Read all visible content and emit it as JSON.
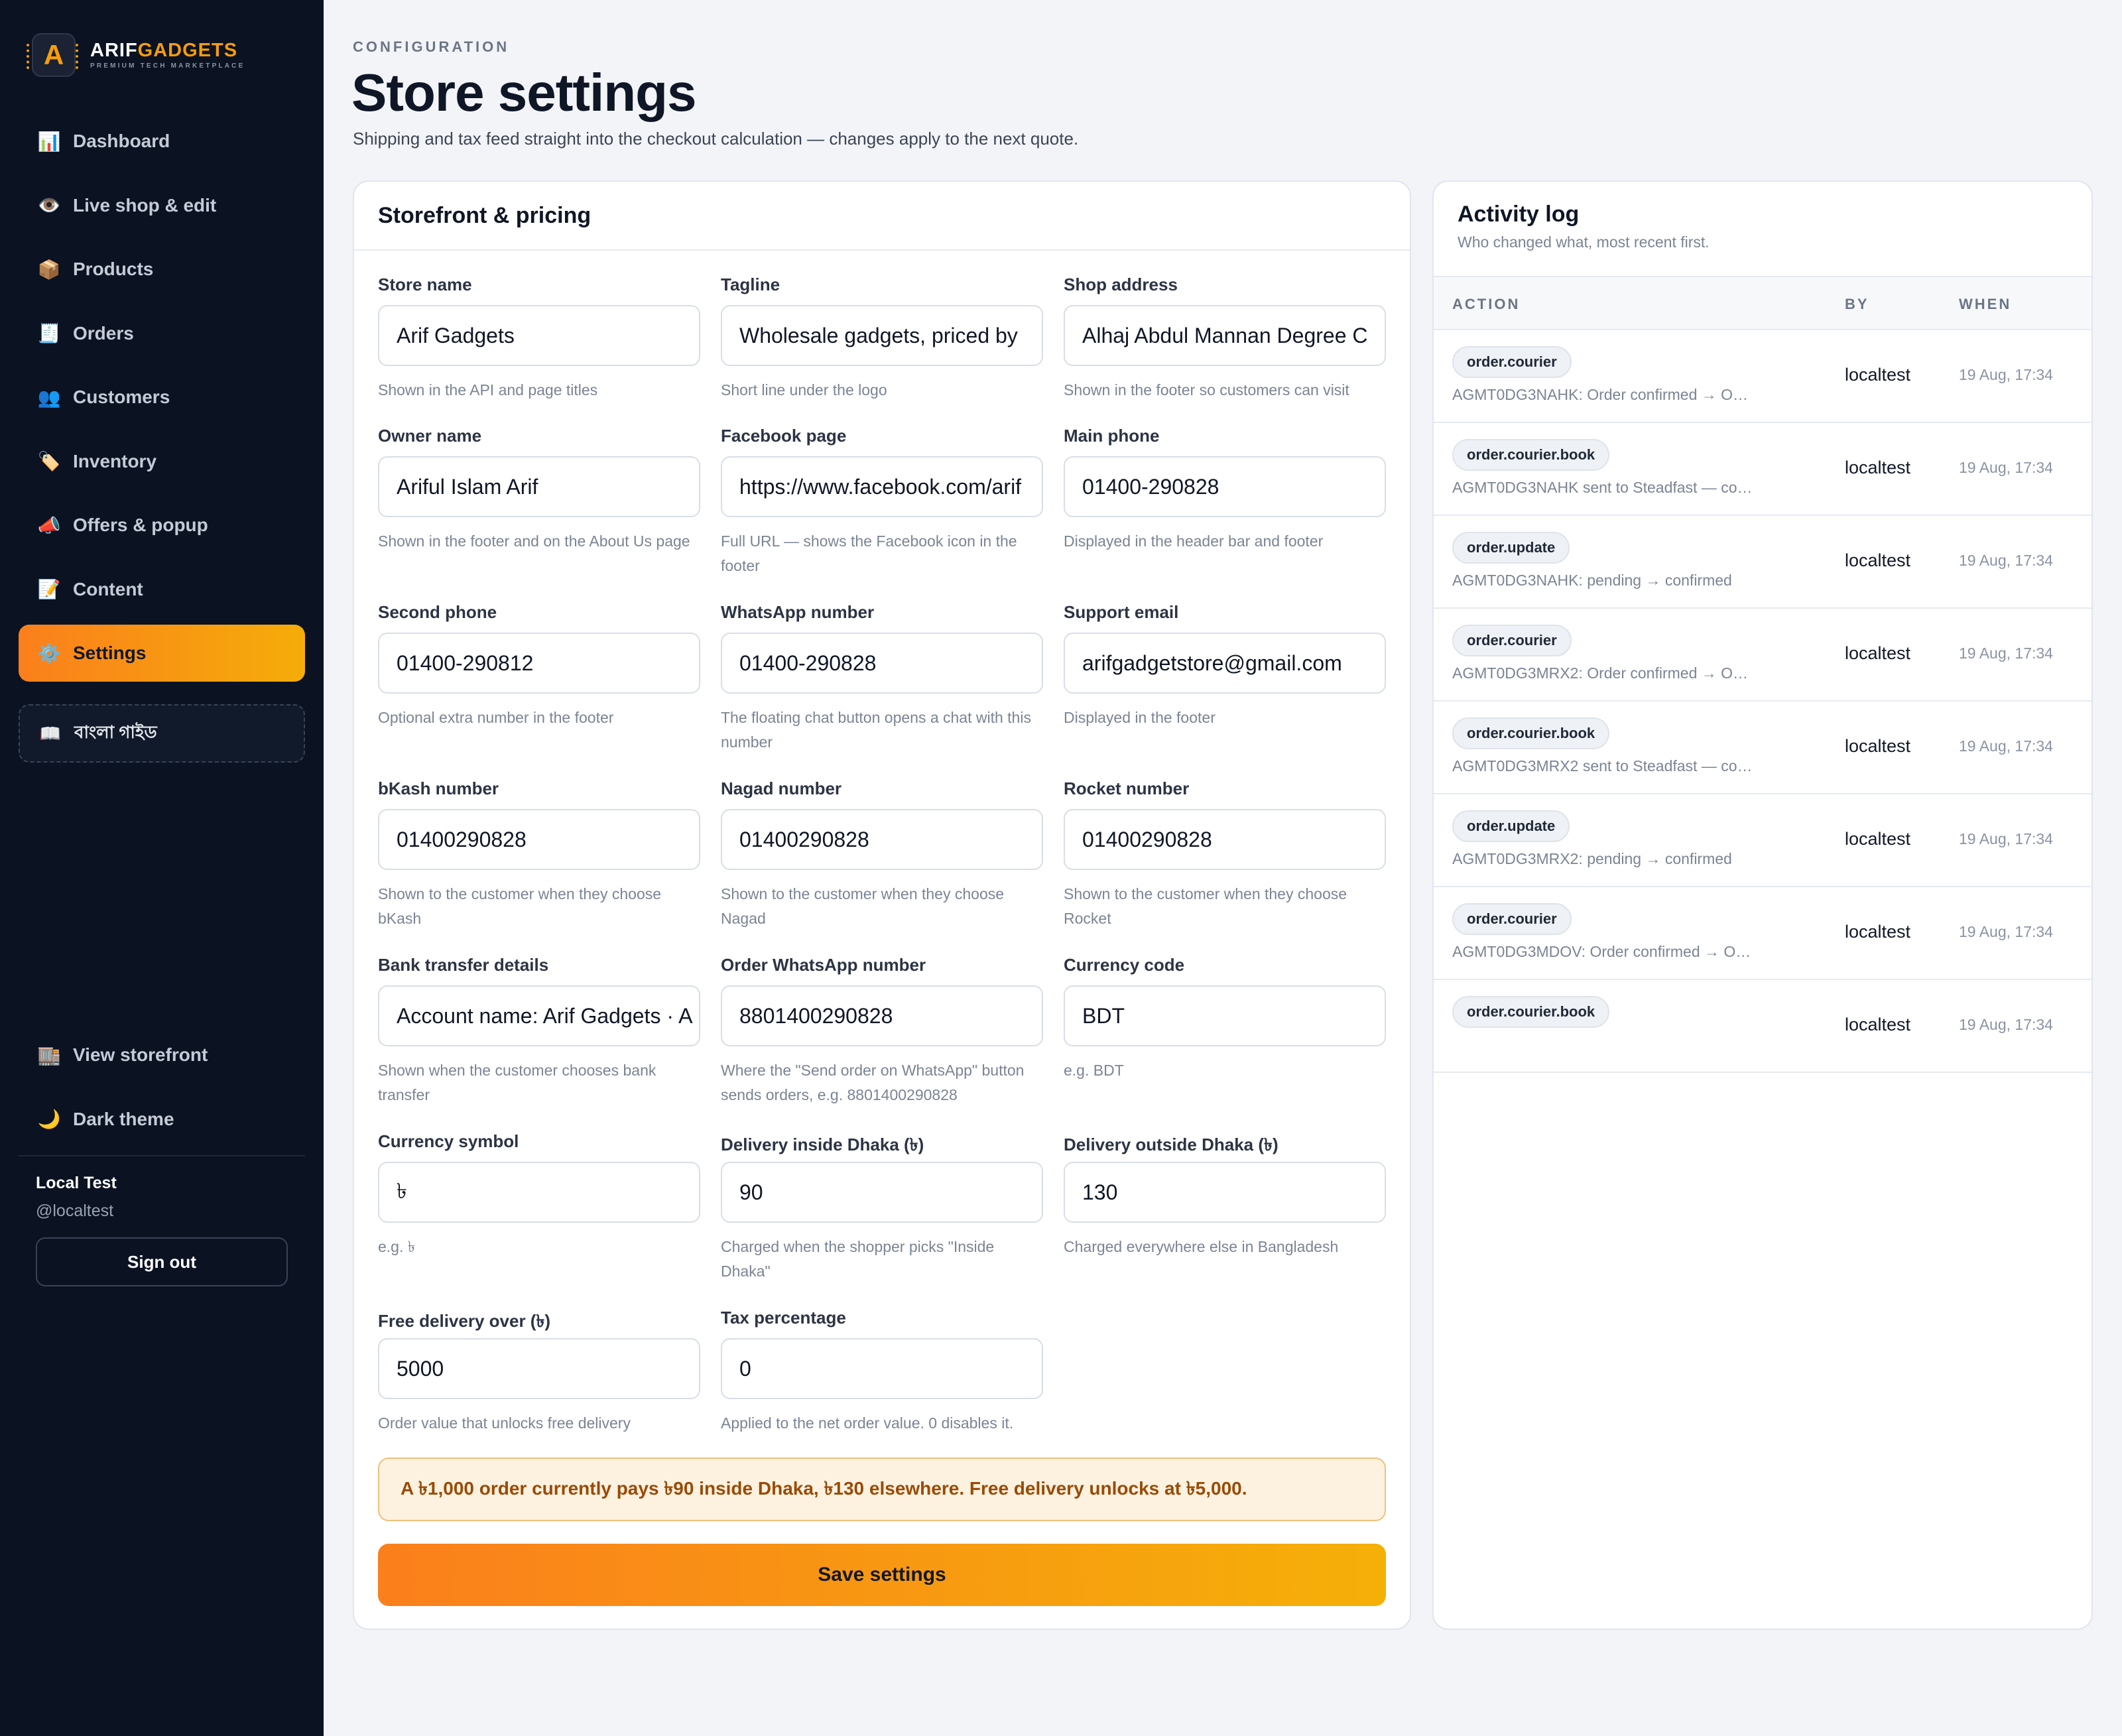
{
  "brand": {
    "name_part1": "ARIF",
    "name_part2": "GADGETS",
    "tagline": "PREMIUM TECH MARKETPLACE",
    "logo_letter": "A"
  },
  "sidebar": {
    "items": [
      {
        "label": "Dashboard",
        "icon": "📊"
      },
      {
        "label": "Live shop & edit",
        "icon": "👁️"
      },
      {
        "label": "Products",
        "icon": "📦"
      },
      {
        "label": "Orders",
        "icon": "🧾"
      },
      {
        "label": "Customers",
        "icon": "👥"
      },
      {
        "label": "Inventory",
        "icon": "🏷️"
      },
      {
        "label": "Offers & popup",
        "icon": "📣"
      },
      {
        "label": "Content",
        "icon": "📝"
      },
      {
        "label": "Settings",
        "icon": "⚙️",
        "active": true
      }
    ],
    "guide": {
      "label": "বাংলা গাইড",
      "icon": "📖"
    },
    "bottom": [
      {
        "label": "View storefront",
        "icon": "🏬"
      },
      {
        "label": "Dark theme",
        "icon": "🌙"
      }
    ],
    "user": {
      "name": "Local Test",
      "handle": "@localtest"
    },
    "signout_label": "Sign out"
  },
  "header": {
    "eyebrow": "CONFIGURATION",
    "title": "Store settings",
    "description": "Shipping and tax feed straight into the checkout calculation — changes apply to the next quote."
  },
  "settings": {
    "panel_title": "Storefront & pricing",
    "fields": [
      {
        "label": "Store name",
        "value": "Arif Gadgets",
        "hint": "Shown in the API and page titles"
      },
      {
        "label": "Tagline",
        "value": "Wholesale gadgets, priced by",
        "hint": "Short line under the logo"
      },
      {
        "label": "Shop address",
        "value": "Alhaj Abdul Mannan Degree C",
        "hint": "Shown in the footer so customers can visit"
      },
      {
        "label": "Owner name",
        "value": "Ariful Islam Arif",
        "hint": "Shown in the footer and on the About Us page"
      },
      {
        "label": "Facebook page",
        "value": "https://www.facebook.com/arif",
        "hint": "Full URL — shows the Facebook icon in the footer"
      },
      {
        "label": "Main phone",
        "value": "01400-290828",
        "hint": "Displayed in the header bar and footer"
      },
      {
        "label": "Second phone",
        "value": "01400-290812",
        "hint": "Optional extra number in the footer"
      },
      {
        "label": "WhatsApp number",
        "value": "01400-290828",
        "hint": "The floating chat button opens a chat with this number"
      },
      {
        "label": "Support email",
        "value": "arifgadgetstore@gmail.com",
        "hint": "Displayed in the footer"
      },
      {
        "label": "bKash number",
        "value": "01400290828",
        "hint": "Shown to the customer when they choose bKash"
      },
      {
        "label": "Nagad number",
        "value": "01400290828",
        "hint": "Shown to the customer when they choose Nagad"
      },
      {
        "label": "Rocket number",
        "value": "01400290828",
        "hint": "Shown to the customer when they choose Rocket"
      },
      {
        "label": "Bank transfer details",
        "value": "Account name: Arif Gadgets · A",
        "hint": "Shown when the customer chooses bank transfer"
      },
      {
        "label": "Order WhatsApp number",
        "value": "8801400290828",
        "hint": "Where the \"Send order on WhatsApp\" button sends orders, e.g. 8801400290828"
      },
      {
        "label": "Currency code",
        "value": "BDT",
        "hint": "e.g. BDT"
      },
      {
        "label": "Currency symbol",
        "value": "৳",
        "hint": "e.g. ৳"
      },
      {
        "label": "Delivery inside Dhaka (৳)",
        "value": "90",
        "hint": "Charged when the shopper picks \"Inside Dhaka\""
      },
      {
        "label": "Delivery outside Dhaka (৳)",
        "value": "130",
        "hint": "Charged everywhere else in Bangladesh"
      },
      {
        "label": "Free delivery over (৳)",
        "value": "5000",
        "hint": "Order value that unlocks free delivery"
      },
      {
        "label": "Tax percentage",
        "value": "0",
        "hint": "Applied to the net order value. 0 disables it."
      }
    ],
    "summary": "A ৳1,000 order currently pays ৳90 inside Dhaka, ৳130 elsewhere. Free delivery unlocks at ৳5,000.",
    "save_label": "Save settings"
  },
  "activity": {
    "title": "Activity log",
    "subtitle": "Who changed what, most recent first.",
    "columns": [
      "ACTION",
      "BY",
      "WHEN"
    ],
    "rows": [
      {
        "action": "order.courier",
        "desc": "AGMT0DG3NAHK: Order confirmed → O…",
        "by": "localtest",
        "when": "19 Aug, 17:34"
      },
      {
        "action": "order.courier.book",
        "desc": "AGMT0DG3NAHK sent to Steadfast — co…",
        "by": "localtest",
        "when": "19 Aug, 17:34"
      },
      {
        "action": "order.update",
        "desc": "AGMT0DG3NAHK: pending → confirmed",
        "by": "localtest",
        "when": "19 Aug, 17:34"
      },
      {
        "action": "order.courier",
        "desc": "AGMT0DG3MRX2: Order confirmed → O…",
        "by": "localtest",
        "when": "19 Aug, 17:34"
      },
      {
        "action": "order.courier.book",
        "desc": "AGMT0DG3MRX2 sent to Steadfast — co…",
        "by": "localtest",
        "when": "19 Aug, 17:34"
      },
      {
        "action": "order.update",
        "desc": "AGMT0DG3MRX2: pending → confirmed",
        "by": "localtest",
        "when": "19 Aug, 17:34"
      },
      {
        "action": "order.courier",
        "desc": "AGMT0DG3MDOV: Order confirmed → O…",
        "by": "localtest",
        "when": "19 Aug, 17:34"
      },
      {
        "action": "order.courier.book",
        "desc": "",
        "by": "localtest",
        "when": "19 Aug, 17:34"
      }
    ]
  },
  "colors": {
    "accent_start": "#fb7f1c",
    "accent_end": "#f5ad09",
    "sidebar_bg": "#0b1222",
    "summary_text": "#9a4a05"
  }
}
